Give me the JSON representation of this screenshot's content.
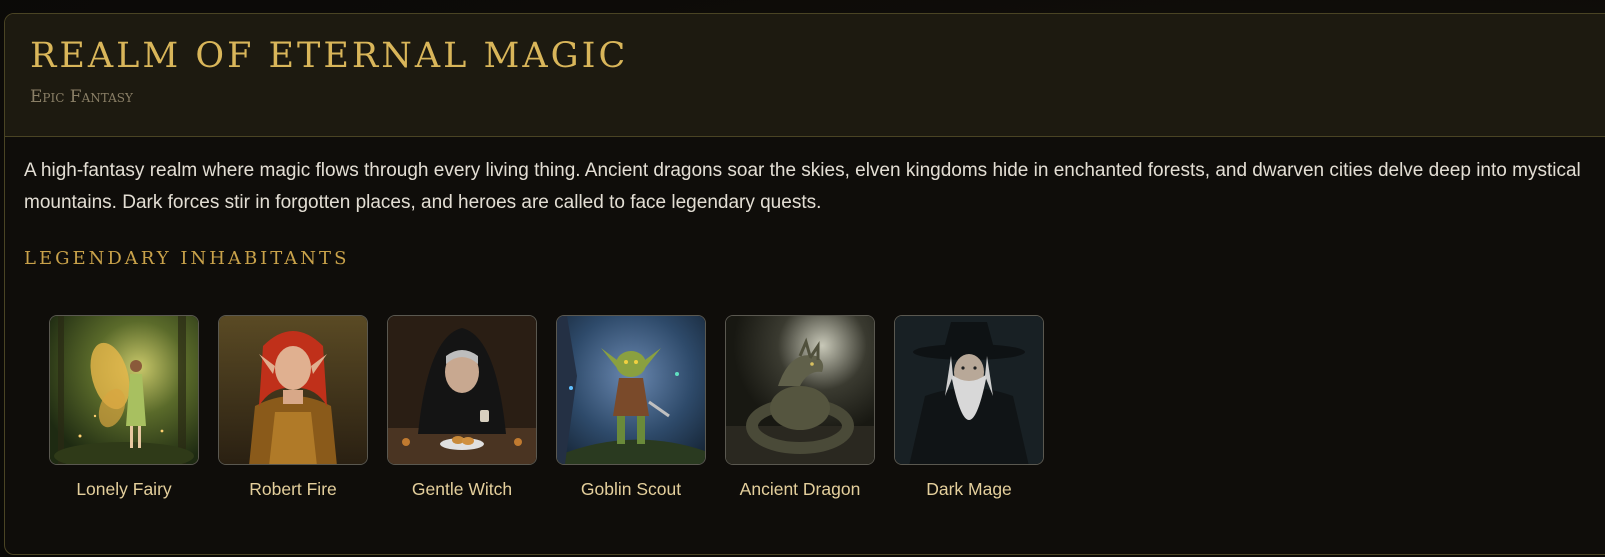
{
  "realm": {
    "title": "REALM OF ETERNAL MAGIC",
    "genre": "Epic Fantasy",
    "description": "A high-fantasy realm where magic flows through every living thing. Ancient dragons soar the skies, elven kingdoms hide in enchanted forests, and dwarven cities delve deep into mystical mountains. Dark forces stir in forgotten places, and heroes are called to face legendary quests."
  },
  "inhabitants_section": {
    "heading": "LEGENDARY INHABITANTS",
    "items": [
      {
        "name": "Lonely Fairy",
        "portrait": "fairy-portrait"
      },
      {
        "name": "Robert Fire",
        "portrait": "elf-portrait"
      },
      {
        "name": "Gentle Witch",
        "portrait": "witch-portrait"
      },
      {
        "name": "Goblin Scout",
        "portrait": "goblin-portrait"
      },
      {
        "name": "Ancient Dragon",
        "portrait": "dragon-portrait"
      },
      {
        "name": "Dark Mage",
        "portrait": "mage-portrait"
      }
    ]
  },
  "colors": {
    "accent_gold": "#d9b65a",
    "header_bg": "#1d1a10",
    "card_border": "#4a4424",
    "name_text": "#e4cf9c"
  }
}
